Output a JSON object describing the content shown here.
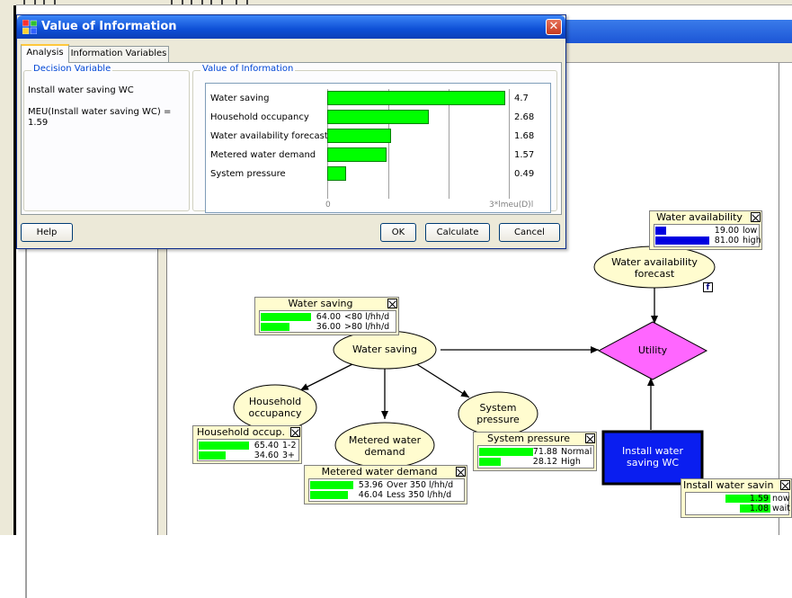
{
  "dialog": {
    "title": "Value of Information",
    "tabs": [
      "Analysis",
      "Information Variables"
    ],
    "decision_group_label": "Decision Variable",
    "decision_variable": "Install water  saving WC",
    "meu_line1": "MEU(Install water  saving WC) =",
    "meu_value": "1.59",
    "voi_group_label": "Value of Information",
    "voi_items": [
      {
        "label": "Water saving",
        "value": "4.7"
      },
      {
        "label": "Household occupancy",
        "value": "2.68"
      },
      {
        "label": "Water availability forecast",
        "value": "1.68"
      },
      {
        "label": "Metered water demand",
        "value": "1.57"
      },
      {
        "label": "System  pressure",
        "value": "0.49"
      }
    ],
    "axis_zero": "0",
    "axis_label": "3*lmeu(D)l",
    "buttons": {
      "help": "Help",
      "ok": "OK",
      "calculate": "Calculate",
      "cancel": "Cancel"
    },
    "close_glyph": "✕"
  },
  "nodes": {
    "water_availability_forecast": "Water availability\nforecast",
    "water_saving": "Water saving",
    "household_occupancy": "Household\noccupancy",
    "metered_water_demand": "Metered water\ndemand",
    "system_pressure": "System\npressure",
    "utility": "Utility",
    "install_wc": "Install water\nsaving WC",
    "function_badge": "f"
  },
  "monitors": {
    "water_availability": {
      "title": "Water availability",
      "rows": [
        {
          "value": "19.00",
          "state": "low",
          "pct": 19
        },
        {
          "value": "81.00",
          "state": "high",
          "pct": 81
        }
      ]
    },
    "water_saving": {
      "title": "Water saving",
      "rows": [
        {
          "value": "64.00",
          "state": "<80 l/hh/d",
          "pct": 64
        },
        {
          "value": "36.00",
          "state": ">80 l/hh/d",
          "pct": 36
        }
      ]
    },
    "household_occupancy": {
      "title": "Household occup.",
      "rows": [
        {
          "value": "65.40",
          "state": "1-2",
          "pct": 65.4
        },
        {
          "value": "34.60",
          "state": "3+",
          "pct": 34.6
        }
      ]
    },
    "metered_water_demand": {
      "title": "Metered water  demand",
      "rows": [
        {
          "value": "53.96",
          "state": "Over 350 l/hh/d",
          "pct": 53.96
        },
        {
          "value": "46.04",
          "state": "Less 350 l/hh/d",
          "pct": 46.04
        }
      ]
    },
    "system_pressure": {
      "title": "System  pressure",
      "rows": [
        {
          "value": "71.88",
          "state": "Normal",
          "pct": 71.88
        },
        {
          "value": "28.12",
          "state": "High",
          "pct": 28.12
        }
      ]
    },
    "install_wc": {
      "title": "Install water  savin",
      "rows": [
        {
          "value": "1.59",
          "state": "now",
          "pct": 100
        },
        {
          "value": "1.08",
          "state": "wait",
          "pct": 68
        }
      ]
    }
  },
  "colors": {
    "bar": "#00ff00",
    "belief_bar_blue": "#0000e0",
    "utility_fill": "#ff66ff",
    "decision_fill": "#0a1ef0",
    "chance_fill": "#fffccf"
  }
}
